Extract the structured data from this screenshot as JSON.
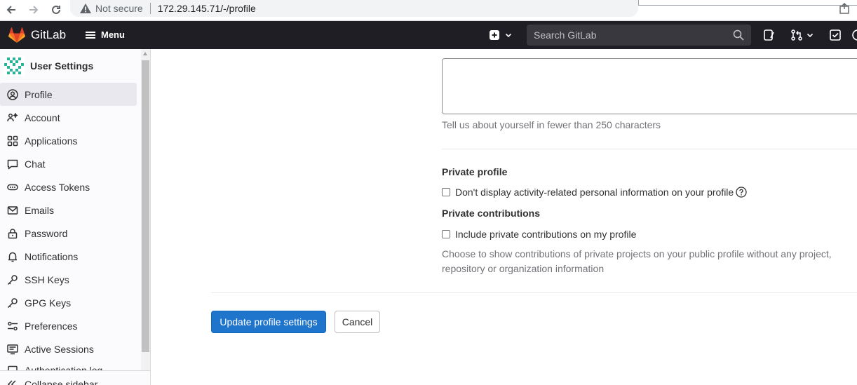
{
  "browser": {
    "security_label": "Not secure",
    "url": "172.29.145.71/-/profile"
  },
  "header": {
    "brand": "GitLab",
    "menu_label": "Menu",
    "search_placeholder": "Search GitLab"
  },
  "sidebar": {
    "title": "User Settings",
    "items": [
      {
        "label": "Profile",
        "icon": "profile-icon",
        "active": true
      },
      {
        "label": "Account",
        "icon": "account-icon"
      },
      {
        "label": "Applications",
        "icon": "applications-icon"
      },
      {
        "label": "Chat",
        "icon": "chat-icon"
      },
      {
        "label": "Access Tokens",
        "icon": "token-icon"
      },
      {
        "label": "Emails",
        "icon": "mail-icon"
      },
      {
        "label": "Password",
        "icon": "lock-icon"
      },
      {
        "label": "Notifications",
        "icon": "bell-icon"
      },
      {
        "label": "SSH Keys",
        "icon": "key-icon"
      },
      {
        "label": "GPG Keys",
        "icon": "key-icon"
      },
      {
        "label": "Preferences",
        "icon": "preferences-icon"
      },
      {
        "label": "Active Sessions",
        "icon": "monitor-icon"
      },
      {
        "label": "Authentication log",
        "icon": "log-icon"
      }
    ],
    "collapse_label": "Collapse sidebar"
  },
  "main": {
    "bio_help": "Tell us about yourself in fewer than 250 characters",
    "private_profile_label": "Private profile",
    "private_profile_checkbox": "Don't display activity-related personal information on your profile",
    "private_contributions_label": "Private contributions",
    "private_contributions_checkbox": "Include private contributions on my profile",
    "private_contributions_help": "Choose to show contributions of private projects on your public profile without any project, repository or organization information",
    "update_button": "Update profile settings",
    "cancel_button": "Cancel"
  },
  "colors": {
    "header_bg": "#1f1e24",
    "primary": "#1f75cb",
    "logo_orange": "#fc6d26"
  }
}
